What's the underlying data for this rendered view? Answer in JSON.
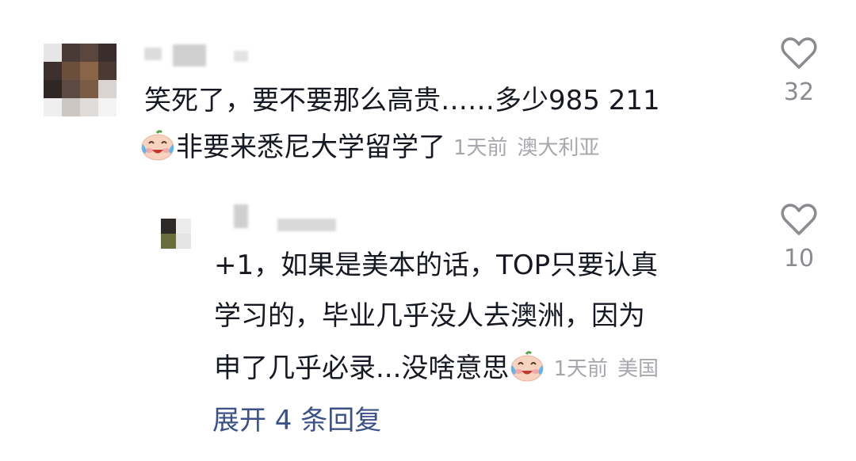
{
  "comment": {
    "line1": "笑死了，要不要那么高贵……多少985 211",
    "line2": "非要来悉尼大学留学了",
    "time": "1天前",
    "location": "澳大利亚",
    "likes": "32"
  },
  "reply": {
    "line1": "+1，如果是美本的话，TOP只要认真",
    "line2": "学习的，毕业几乎没人去澳洲，因为",
    "line3": "申了几乎必录...没啥意思",
    "time": "1天前",
    "location": "美国",
    "likes": "10"
  },
  "expand_label": "展开 4 条回复",
  "icons": {
    "like": "heart-outline-icon",
    "emoji": "crying-laughing-emoji-icon"
  },
  "colors": {
    "text": "#161823",
    "meta": "#a7a8ad",
    "count": "#8a8b91",
    "link": "#3b5188"
  }
}
